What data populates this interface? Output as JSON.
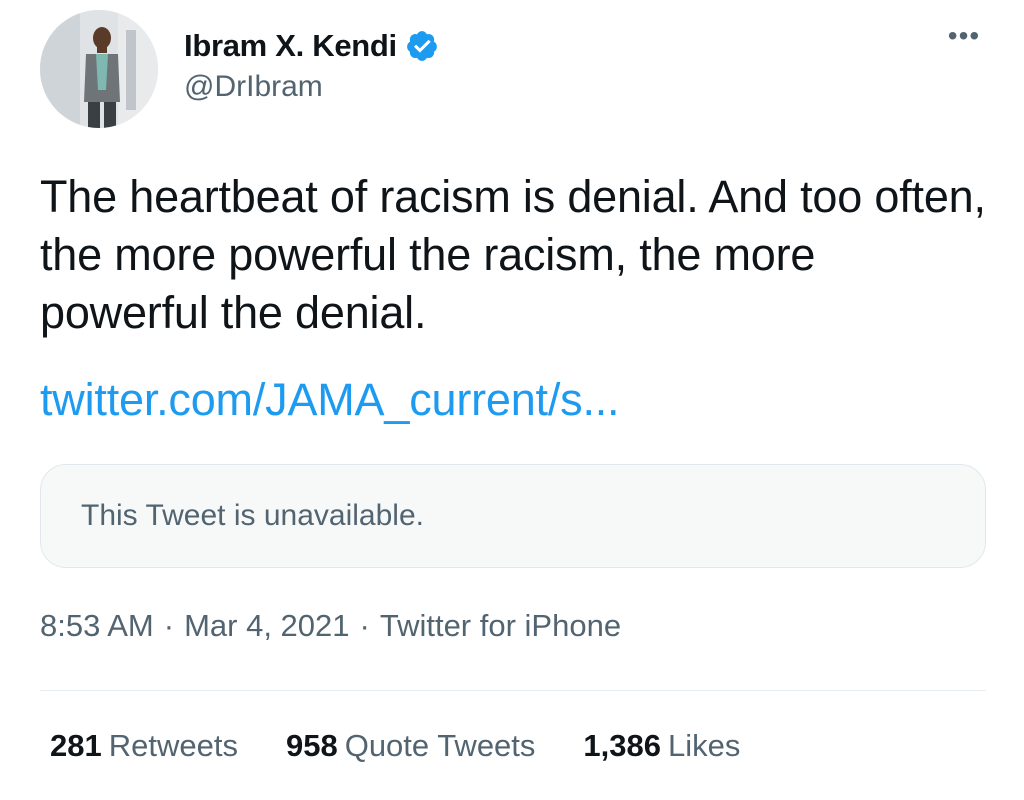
{
  "author": {
    "display_name": "Ibram X. Kendi",
    "handle": "@DrIbram",
    "verified": true,
    "avatar_icon": "profile-photo",
    "verified_icon": "verified-badge-icon",
    "verified_color": "#1d9bf0"
  },
  "more_options": "•••",
  "tweet": {
    "text": "The heartbeat of racism is denial. And too often, the more powerful the racism, the more powerful the denial.",
    "link": "twitter.com/JAMA_current/s..."
  },
  "quote": {
    "text": "This Tweet is unavailable."
  },
  "meta": {
    "time": "8:53 AM",
    "separator": "·",
    "date": "Mar 4, 2021",
    "source": "Twitter for iPhone"
  },
  "stats": {
    "retweets_count": "281",
    "retweets_label": "Retweets",
    "quotes_count": "958",
    "quotes_label": "Quote Tweets",
    "likes_count": "1,386",
    "likes_label": "Likes"
  },
  "colors": {
    "text": "#0f1419",
    "secondary": "#536471",
    "link": "#1d9bf0",
    "quote_bg": "#f7f9f9"
  }
}
